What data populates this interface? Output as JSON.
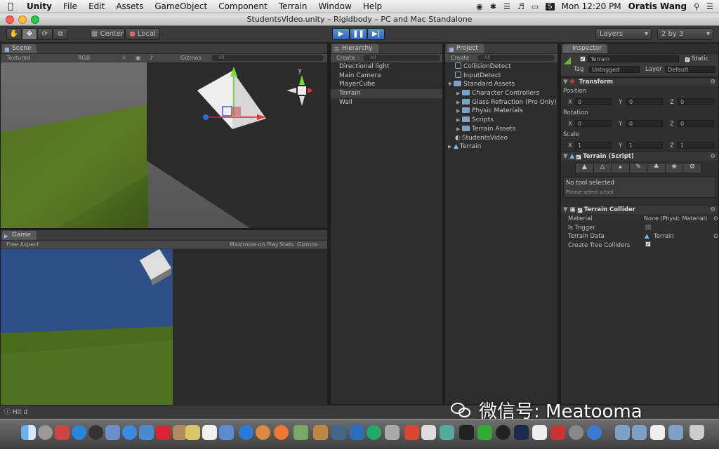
{
  "menubar": {
    "app": "Unity",
    "items": [
      "File",
      "Edit",
      "Assets",
      "GameObject",
      "Component",
      "Terrain",
      "Window",
      "Help"
    ],
    "clock": "Mon 12:20 PM",
    "user": "Oratis Wang",
    "status_icon": "S"
  },
  "window": {
    "title": "StudentsVideo.unity – Rigidbody – PC and Mac Standalone"
  },
  "toolbar": {
    "pivot_center": "Center",
    "pivot_local": "Local",
    "layers": "Layers",
    "layout": "2 by 3",
    "play_icon": "play-icon",
    "pause_icon": "pause-icon",
    "step_icon": "step-icon"
  },
  "scene": {
    "tab": "Scene",
    "render_mode": "Textured",
    "color_mode": "RGB",
    "gizmos": "Gizmos",
    "search_placeholder": "All",
    "axis_label": "y"
  },
  "game": {
    "tab": "Game",
    "aspect": "Free Aspect",
    "maximize": "Maximize on Play",
    "stats": "Stats",
    "gizmos": "Gizmos"
  },
  "hierarchy": {
    "tab": "Hierarchy",
    "create": "Create",
    "search_placeholder": "All",
    "items": [
      {
        "label": "Directional light"
      },
      {
        "label": "Main Camera"
      },
      {
        "label": "PlayerCube"
      },
      {
        "label": "Terrain",
        "selected": true
      },
      {
        "label": "Wall"
      }
    ]
  },
  "project": {
    "tab": "Project",
    "create": "Create",
    "search_placeholder": "All",
    "items": [
      {
        "label": "CollisionDetect",
        "indent": 0,
        "type": "script"
      },
      {
        "label": "InputDetect",
        "indent": 0,
        "type": "script"
      },
      {
        "label": "Standard Assets",
        "indent": 0,
        "type": "folder",
        "open": true
      },
      {
        "label": "Character Controllers",
        "indent": 1,
        "type": "folder"
      },
      {
        "label": "Glass Refraction (Pro Only)",
        "indent": 1,
        "type": "folder"
      },
      {
        "label": "Physic Materials",
        "indent": 1,
        "type": "folder"
      },
      {
        "label": "Scripts",
        "indent": 1,
        "type": "folder"
      },
      {
        "label": "Terrain Assets",
        "indent": 1,
        "type": "folder"
      },
      {
        "label": "StudentsVideo",
        "indent": 0,
        "type": "scene"
      },
      {
        "label": "Terrain",
        "indent": 0,
        "type": "terrain",
        "collapsed": true
      }
    ]
  },
  "inspector": {
    "tab": "Inspector",
    "object_name": "Terrain",
    "static_label": "Static",
    "tag_label": "Tag",
    "tag_value": "Untagged",
    "layer_label": "Layer",
    "layer_value": "Default",
    "transform": {
      "title": "Transform",
      "position_label": "Position",
      "rotation_label": "Rotation",
      "scale_label": "Scale",
      "position": {
        "x": "0",
        "y": "0",
        "z": "0"
      },
      "rotation": {
        "x": "0",
        "y": "0",
        "z": "0"
      },
      "scale": {
        "x": "1",
        "y": "1",
        "z": "1"
      }
    },
    "terrain_script": {
      "title": "Terrain (Script)",
      "no_tool": "No tool selected",
      "hint": "Please select a tool"
    },
    "terrain_collider": {
      "title": "Terrain Collider",
      "material_label": "Material",
      "material_value": "None (Physic Material)",
      "trigger_label": "Is Trigger",
      "data_label": "Terrain Data",
      "data_value": "Terrain",
      "trees_label": "Create Tree Colliders"
    }
  },
  "statusbar": {
    "message": "Hit d"
  },
  "watermark": {
    "text": "微信号: Meatooma"
  }
}
